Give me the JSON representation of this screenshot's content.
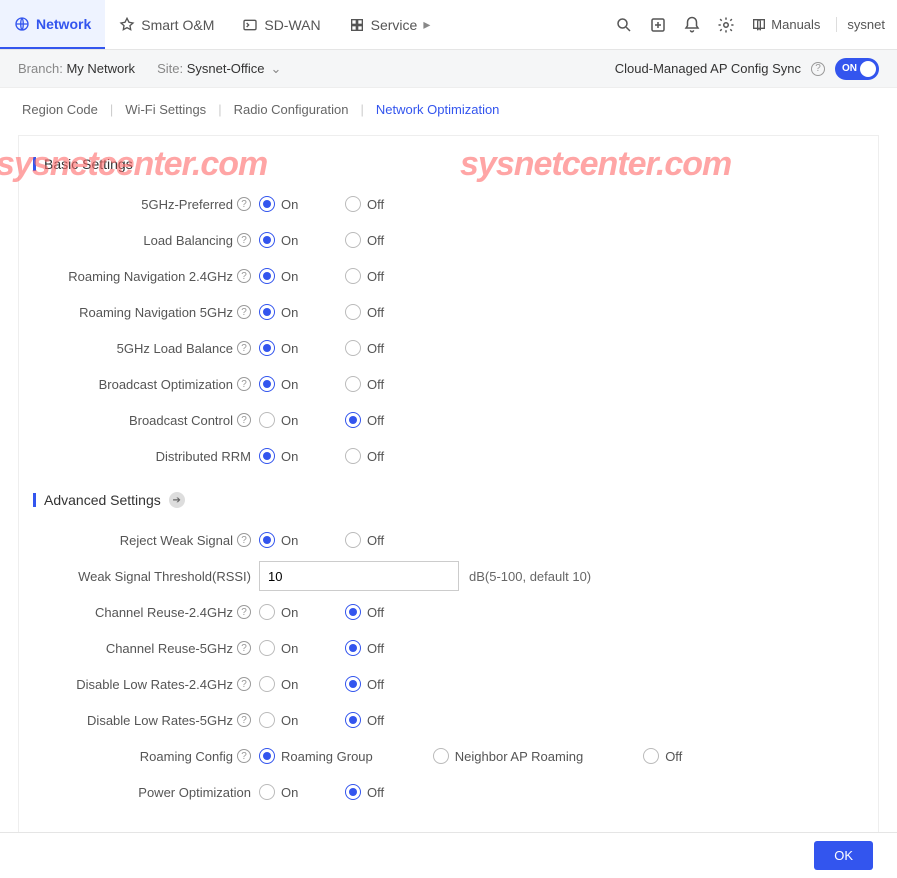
{
  "topnav": {
    "network": "Network",
    "smart_om": "Smart O&M",
    "sdwan": "SD-WAN",
    "service": "Service"
  },
  "topright": {
    "manuals": "Manuals",
    "user": "sysnet"
  },
  "subbar": {
    "branch_label": "Branch:",
    "branch_value": "My Network",
    "site_label": "Site:",
    "site_value": "Sysnet-Office",
    "sync_label": "Cloud-Managed AP Config Sync",
    "toggle_text": "ON"
  },
  "tabs": {
    "region": "Region Code",
    "wifi": "Wi-Fi Settings",
    "radio": "Radio Configuration",
    "netopt": "Network Optimization"
  },
  "basic": {
    "title": "Basic Settings",
    "on": "On",
    "off": "Off",
    "items": {
      "ghz5pref": "5GHz-Preferred",
      "loadbal": "Load Balancing",
      "roam24": "Roaming Navigation 2.4GHz",
      "roam5": "Roaming Navigation 5GHz",
      "ghz5lb": "5GHz Load Balance",
      "bcastopt": "Broadcast Optimization",
      "bcastctl": "Broadcast Control",
      "drrm": "Distributed RRM"
    }
  },
  "advanced": {
    "title": "Advanced Settings",
    "on": "On",
    "off": "Off",
    "reject_weak": "Reject Weak Signal",
    "weak_threshold_label": "Weak Signal Threshold(RSSI)",
    "weak_threshold_value": "10",
    "weak_threshold_suffix": "dB(5-100, default 10)",
    "chreuse24": "Channel Reuse-2.4GHz",
    "chreuse5": "Channel Reuse-5GHz",
    "dlr24": "Disable Low Rates-2.4GHz",
    "dlr5": "Disable Low Rates-5GHz",
    "roamcfg": "Roaming Config",
    "roamcfg_opts": {
      "group": "Roaming Group",
      "neighbor": "Neighbor AP Roaming",
      "off": "Off"
    },
    "poweropt": "Power Optimization"
  },
  "footer": {
    "ok": "OK"
  },
  "watermark": "sysnetcenter.com"
}
